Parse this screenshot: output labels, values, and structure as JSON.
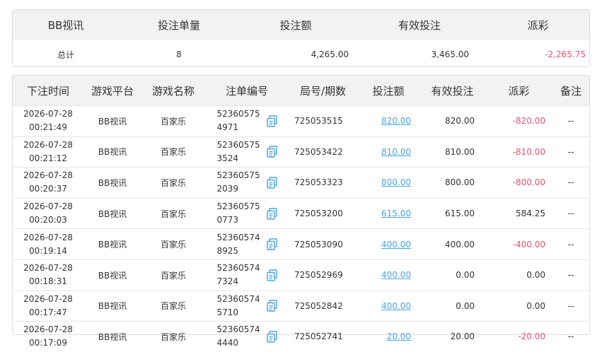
{
  "summary": {
    "headers": [
      "BB视讯",
      "投注单量",
      "投注额",
      "有效投注",
      "派彩"
    ],
    "row": {
      "label": "总计",
      "count": "8",
      "bet": "4,265.00",
      "valid": "3,465.00",
      "payout": "-2,265.75"
    }
  },
  "detail": {
    "headers": [
      "下注时间",
      "游戏平台",
      "游戏名称",
      "注单编号",
      "局号/期数",
      "投注额",
      "有效投注",
      "派彩",
      "备注"
    ],
    "rows": [
      {
        "date": "2026-07-28",
        "time": "00:21:49",
        "platform": "BB视讯",
        "game": "百家乐",
        "order": "523605754971",
        "round": "725053515",
        "bet": "820.00",
        "valid": "820.00",
        "payout": "-820.00",
        "note": "--"
      },
      {
        "date": "2026-07-28",
        "time": "00:21:12",
        "platform": "BB视讯",
        "game": "百家乐",
        "order": "523605753524",
        "round": "725053422",
        "bet": "810.00",
        "valid": "810.00",
        "payout": "-810.00",
        "note": "--"
      },
      {
        "date": "2026-07-28",
        "time": "00:20:37",
        "platform": "BB视讯",
        "game": "百家乐",
        "order": "523605752039",
        "round": "725053323",
        "bet": "800.00",
        "valid": "800.00",
        "payout": "-800.00",
        "note": "--"
      },
      {
        "date": "2026-07-28",
        "time": "00:20:03",
        "platform": "BB视讯",
        "game": "百家乐",
        "order": "523605750773",
        "round": "725053200",
        "bet": "615.00",
        "valid": "615.00",
        "payout": "584.25",
        "note": "--"
      },
      {
        "date": "2026-07-28",
        "time": "00:19:14",
        "platform": "BB视讯",
        "game": "百家乐",
        "order": "523605748925",
        "round": "725053090",
        "bet": "400.00",
        "valid": "400.00",
        "payout": "-400.00",
        "note": "--"
      },
      {
        "date": "2026-07-28",
        "time": "00:18:31",
        "platform": "BB视讯",
        "game": "百家乐",
        "order": "523605747324",
        "round": "725052969",
        "bet": "400.00",
        "valid": "0.00",
        "payout": "0.00",
        "note": "--"
      },
      {
        "date": "2026-07-28",
        "time": "00:17:47",
        "platform": "BB视讯",
        "game": "百家乐",
        "order": "523605745710",
        "round": "725052842",
        "bet": "400.00",
        "valid": "0.00",
        "payout": "0.00",
        "note": "--"
      },
      {
        "date": "2026-07-28",
        "time": "00:17:09",
        "platform": "BB视讯",
        "game": "百家乐",
        "order": "523605744440",
        "round": "725052741",
        "bet": "20.00",
        "valid": "20.00",
        "payout": "-20.00",
        "note": "--"
      }
    ]
  },
  "icons": {
    "copy": "copy-icon"
  },
  "colors": {
    "negative": "#e5536b",
    "link": "#4aa3df",
    "header_bg": "#f2f2f2"
  }
}
